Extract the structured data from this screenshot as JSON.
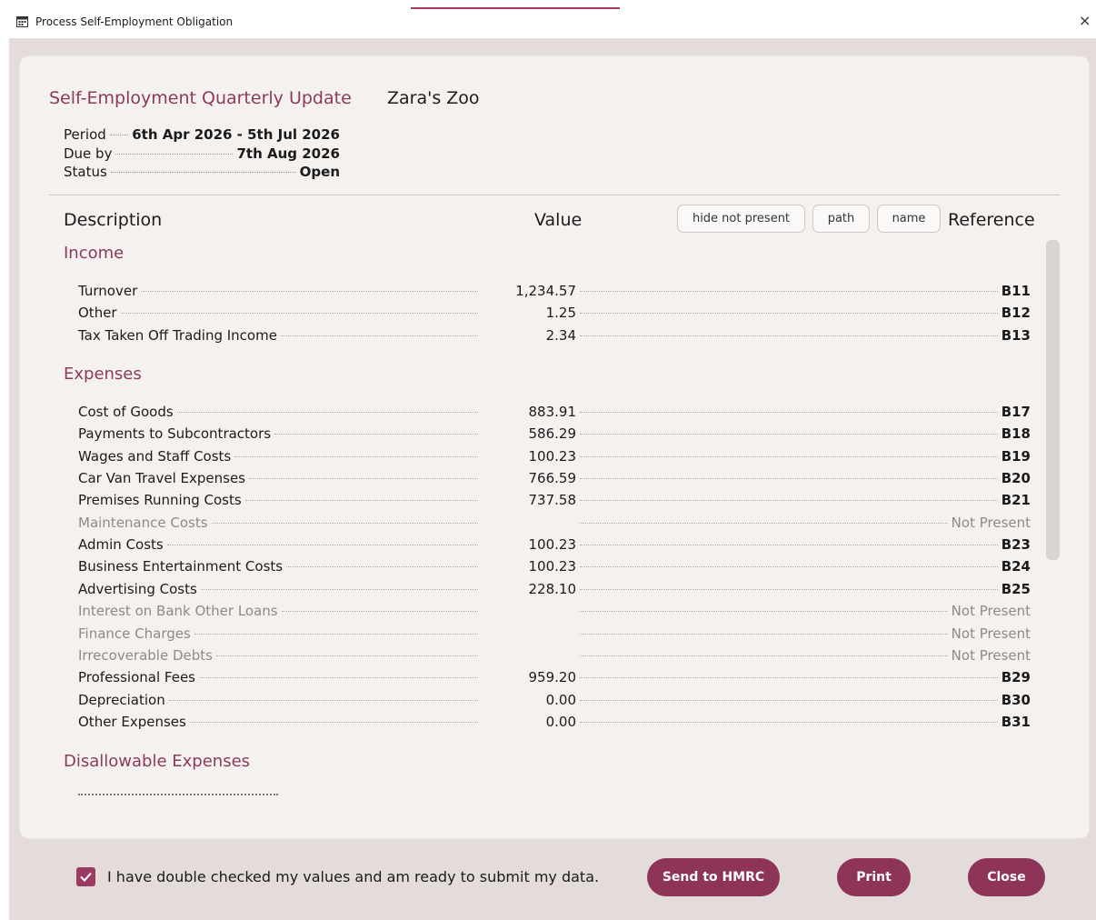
{
  "window": {
    "title": "Process Self-Employment Obligation",
    "close_glyph": "×"
  },
  "header": {
    "title": "Self-Employment Quarterly Update",
    "business": "Zara's Zoo",
    "period_label": "Period",
    "period_value": "6th Apr 2026 - 5th Jul 2026",
    "due_label": "Due by",
    "due_value": "7th Aug 2026",
    "status_label": "Status",
    "status_value": "Open"
  },
  "columns": {
    "description": "Description",
    "value": "Value",
    "reference": "Reference"
  },
  "toggles": {
    "hide_not_present": "hide not present",
    "path": "path",
    "name": "name"
  },
  "sections": {
    "income": {
      "title": "Income",
      "rows": [
        {
          "desc": "Turnover",
          "value": "1,234.57",
          "ref": "B11"
        },
        {
          "desc": "Other",
          "value": "1.25",
          "ref": "B12"
        },
        {
          "desc": "Tax Taken Off Trading Income",
          "value": "2.34",
          "ref": "B13"
        }
      ]
    },
    "expenses": {
      "title": "Expenses",
      "rows": [
        {
          "desc": "Cost of Goods",
          "value": "883.91",
          "ref": "B17"
        },
        {
          "desc": "Payments to Subcontractors",
          "value": "586.29",
          "ref": "B18"
        },
        {
          "desc": "Wages and Staff Costs",
          "value": "100.23",
          "ref": "B19"
        },
        {
          "desc": "Car Van Travel Expenses",
          "value": "766.59",
          "ref": "B20"
        },
        {
          "desc": "Premises Running Costs",
          "value": "737.58",
          "ref": "B21"
        },
        {
          "desc": "Maintenance Costs",
          "value": "",
          "ref": "Not Present"
        },
        {
          "desc": "Admin Costs",
          "value": "100.23",
          "ref": "B23"
        },
        {
          "desc": "Business Entertainment Costs",
          "value": "100.23",
          "ref": "B24"
        },
        {
          "desc": "Advertising Costs",
          "value": "228.10",
          "ref": "B25"
        },
        {
          "desc": "Interest on Bank Other Loans",
          "value": "",
          "ref": "Not Present"
        },
        {
          "desc": "Finance Charges",
          "value": "",
          "ref": "Not Present"
        },
        {
          "desc": "Irrecoverable Debts",
          "value": "",
          "ref": "Not Present"
        },
        {
          "desc": "Professional Fees",
          "value": "959.20",
          "ref": "B29"
        },
        {
          "desc": "Depreciation",
          "value": "0.00",
          "ref": "B30"
        },
        {
          "desc": "Other Expenses",
          "value": "0.00",
          "ref": "B31"
        }
      ]
    },
    "disallowable": {
      "title": "Disallowable Expenses"
    }
  },
  "footer": {
    "confirm_label": "I have double checked my values and am ready to submit my data.",
    "confirm_checked": true,
    "send_label": "Send to HMRC",
    "print_label": "Print",
    "close_label": "Close"
  },
  "colors": {
    "accent": "#8f3459",
    "heading": "#8b3a5c",
    "not_present_text": "#8f8a88"
  }
}
